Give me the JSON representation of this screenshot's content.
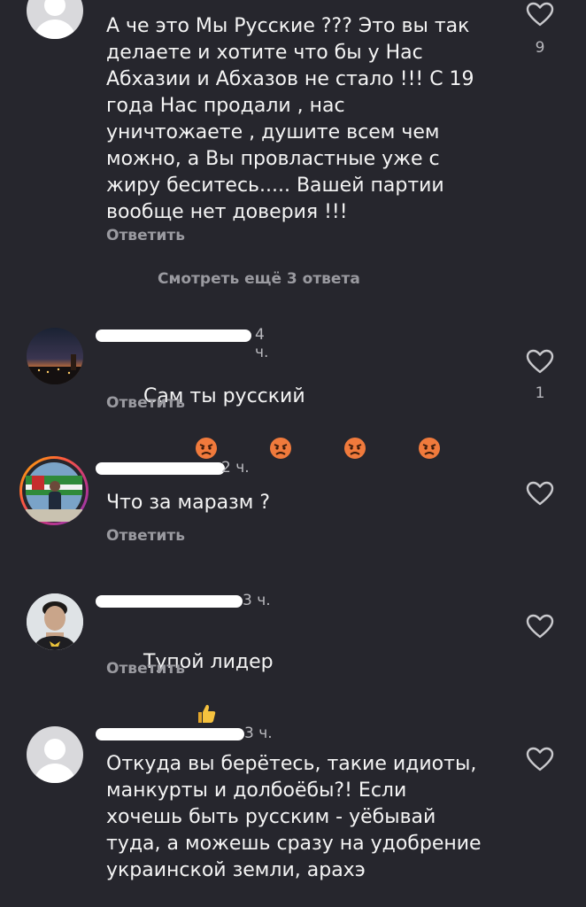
{
  "comments": [
    {
      "text": "А че это Мы Русские ??? Это вы так\nделаете и хотите что бы у Нас\nАбхазии и Абхазов не стало !!! С 19\nгода Нас продали , нас\nуничтожаете , душите всем чем\nможно, а Вы провластные уже с\nжиру беситесь..... Вашей партии\nвообще нет доверия !!!",
      "reply_label": "Ответить",
      "likes": "9"
    },
    {
      "time": "4 ч.",
      "text": "Сам ты русский",
      "reply_label": "Ответить",
      "likes": "1",
      "emoji": [
        "angry-face",
        "angry-face",
        "angry-face",
        "angry-face"
      ]
    },
    {
      "time": "2 ч.",
      "text": "Что за маразм ?",
      "reply_label": "Ответить"
    },
    {
      "time": "3 ч.",
      "text": "Тупой лидер",
      "reply_label": "Ответить",
      "emoji": [
        "thumbs-up"
      ]
    },
    {
      "time": "3 ч.",
      "text": "Откуда вы берётесь, такие идиоты,\nманкурты и долбоёбы?! Если\nхочешь быть русским - уёбывай\nтуда, а можешь сразу на удобрение\nукраинской земли, арахэ"
    }
  ],
  "more_replies_label": "Смотреть ещё 3 ответа",
  "icons": {
    "like": "heart-outline-icon",
    "angry": "angry-face-emoji",
    "thumbs": "thumbs-up-emoji"
  },
  "colors": {
    "background": "#26262d",
    "text": "#f4f4f4",
    "secondary": "#9a9aa0"
  }
}
